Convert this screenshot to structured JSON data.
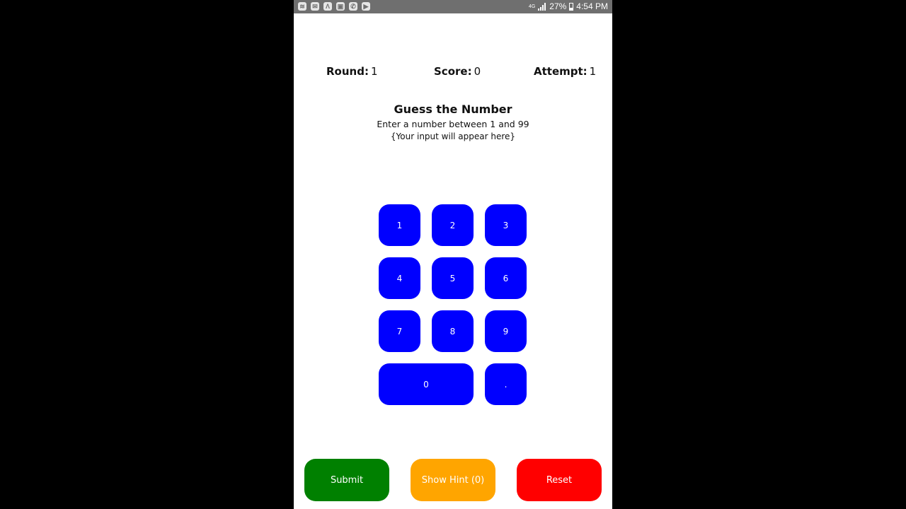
{
  "status_bar": {
    "icons": [
      "wifi-icon",
      "messenger-icon",
      "app-icon",
      "image-icon",
      "whatsapp-icon",
      "play-store-icon"
    ],
    "network": "4G",
    "battery": "27%",
    "time": "4:54 PM"
  },
  "stats": {
    "round_label": "Round:",
    "round_value": "1",
    "score_label": "Score:",
    "score_value": "0",
    "attempt_label": "Attempt:",
    "attempt_value": "1"
  },
  "game": {
    "title": "Guess the Number",
    "instruction": "Enter a number between 1 and 99",
    "input_placeholder": "{Your input will appear here}"
  },
  "keypad": {
    "k1": "1",
    "k2": "2",
    "k3": "3",
    "k4": "4",
    "k5": "5",
    "k6": "6",
    "k7": "7",
    "k8": "8",
    "k9": "9",
    "k0": "0",
    "dot": "."
  },
  "actions": {
    "submit": "Submit",
    "hint": "Show Hint (0)",
    "reset": "Reset"
  },
  "colors": {
    "keypad": "#0000ff",
    "submit": "#008000",
    "hint": "#ffa500",
    "reset": "#ff0000"
  }
}
